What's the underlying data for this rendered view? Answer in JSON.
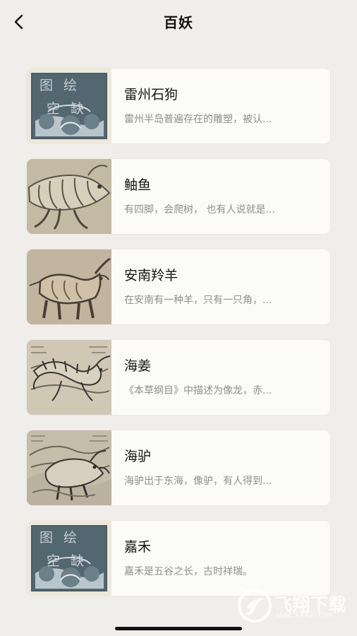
{
  "header": {
    "title": "百妖"
  },
  "items": [
    {
      "title": "雷州石狗",
      "description": "雷州半岛普遍存在的雕塑，被认...",
      "thumb": "missing-illustration"
    },
    {
      "title": "鲉鱼",
      "description": "有四脚，会爬树， 也有人说就是...",
      "thumb": "fish-illustration"
    },
    {
      "title": "安南羚羊",
      "description": "在安南有一种羊，只有一只角，...",
      "thumb": "goat-illustration"
    },
    {
      "title": "海姜",
      "description": "《本草纲目》中描述为像龙，赤...",
      "thumb": "sea-dragon-illustration"
    },
    {
      "title": "海驴",
      "description": "海驴出于东海，像驴，有人得到...",
      "thumb": "sea-donkey-illustration"
    },
    {
      "title": "嘉禾",
      "description": "嘉禾是五谷之长，古时祥瑞。",
      "thumb": "missing-illustration"
    }
  ],
  "placeholder_stamp": "图绘 空缺",
  "watermark": {
    "text": "飞翔下载",
    "url": "WWW.FXXZ.COM"
  }
}
